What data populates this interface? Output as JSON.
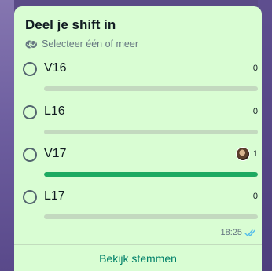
{
  "poll": {
    "title": "Deel je shift in",
    "subtitle": "Selecteer één of meer",
    "options": [
      {
        "label": "V16",
        "count": "0",
        "fill_fraction": 0,
        "has_voter_avatar": false
      },
      {
        "label": "L16",
        "count": "0",
        "fill_fraction": 0,
        "has_voter_avatar": false
      },
      {
        "label": "V17",
        "count": "1",
        "fill_fraction": 1,
        "has_voter_avatar": true
      },
      {
        "label": "L17",
        "count": "0",
        "fill_fraction": 0,
        "has_voter_avatar": false
      }
    ],
    "time": "18:25",
    "status_icon": "double-check-read-icon",
    "view_votes_label": "Bekijk stemmen"
  },
  "colors": {
    "bubble": "#d9fdd3",
    "bar_track": "#c3d9bf",
    "bar_fill": "#1daa61",
    "read_ticks": "#53bdeb",
    "action_text": "#008069",
    "background": "#5a4a86"
  }
}
